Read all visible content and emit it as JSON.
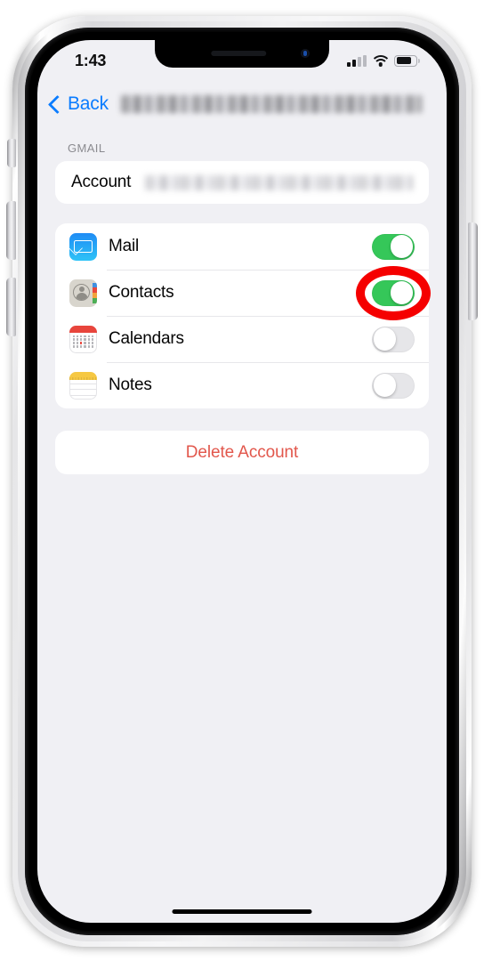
{
  "device": {
    "name": "iPhone",
    "frame_color": "#e8e8ea"
  },
  "status_bar": {
    "time": "1:43",
    "signal_icon": "cellular-signal-icon",
    "signal_bars_filled": 2,
    "signal_bars_total": 4,
    "wifi_icon": "wifi-icon",
    "battery_icon": "battery-icon",
    "battery_level_percent": 68
  },
  "nav_bar": {
    "back_icon": "chevron-left-icon",
    "back_label": "Back",
    "title": "",
    "title_redacted": true,
    "accent_color": "#0a7cff"
  },
  "main": {
    "section_header": "GMAIL",
    "account_row": {
      "label": "Account",
      "value": "",
      "value_redacted": true
    },
    "services": [
      {
        "label": "Mail",
        "icon": "mail-app-icon",
        "enabled": true,
        "highlighted": false
      },
      {
        "label": "Contacts",
        "icon": "contacts-app-icon",
        "enabled": true,
        "highlighted": true
      },
      {
        "label": "Calendars",
        "icon": "calendar-app-icon",
        "enabled": false,
        "highlighted": false
      },
      {
        "label": "Notes",
        "icon": "notes-app-icon",
        "enabled": false,
        "highlighted": false
      }
    ],
    "delete_button": {
      "label": "Delete Account",
      "color": "#e2574c"
    }
  },
  "annotation": {
    "type": "ellipse-highlight",
    "color": "#f50000",
    "target": "contacts-toggle"
  },
  "home_indicator": "home-indicator"
}
